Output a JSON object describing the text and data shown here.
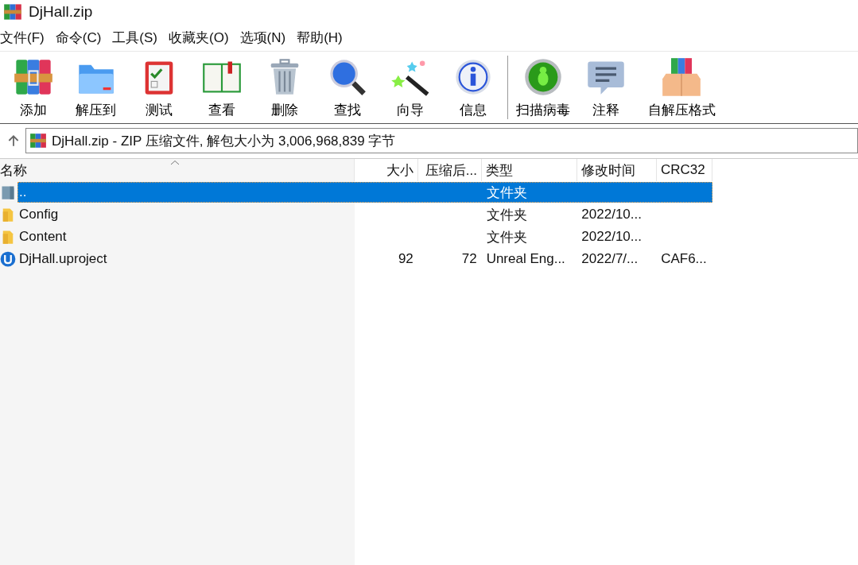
{
  "window": {
    "title": "DjHall.zip"
  },
  "menu": [
    "文件(F)",
    "命令(C)",
    "工具(S)",
    "收藏夹(O)",
    "选项(N)",
    "帮助(H)"
  ],
  "toolbar": [
    {
      "label": "添加"
    },
    {
      "label": "解压到"
    },
    {
      "label": "测试"
    },
    {
      "label": "查看"
    },
    {
      "label": "删除"
    },
    {
      "label": "查找"
    },
    {
      "label": "向导"
    },
    {
      "label": "信息"
    },
    {
      "label": "扫描病毒"
    },
    {
      "label": "注释"
    },
    {
      "label": "自解压格式"
    }
  ],
  "address": "DjHall.zip - ZIP 压缩文件, 解包大小为 3,006,968,839 字节",
  "table": {
    "columns": [
      "名称",
      "大小",
      "压缩后...",
      "类型",
      "修改时间",
      "CRC32"
    ],
    "rows": [
      {
        "kind": "parent",
        "name": "..",
        "size": "",
        "packed": "",
        "type": "文件夹",
        "modified": "",
        "crc": "",
        "selected": true
      },
      {
        "kind": "folder",
        "name": "Config",
        "size": "",
        "packed": "",
        "type": "文件夹",
        "modified": "2022/10...",
        "crc": "",
        "selected": false
      },
      {
        "kind": "folder",
        "name": "Content",
        "size": "",
        "packed": "",
        "type": "文件夹",
        "modified": "2022/10...",
        "crc": "",
        "selected": false
      },
      {
        "kind": "file",
        "name": "DjHall.uproject",
        "size": "92",
        "packed": "72",
        "type": "Unreal Eng...",
        "modified": "2022/7/...",
        "crc": "CAF6...",
        "selected": false
      }
    ]
  }
}
